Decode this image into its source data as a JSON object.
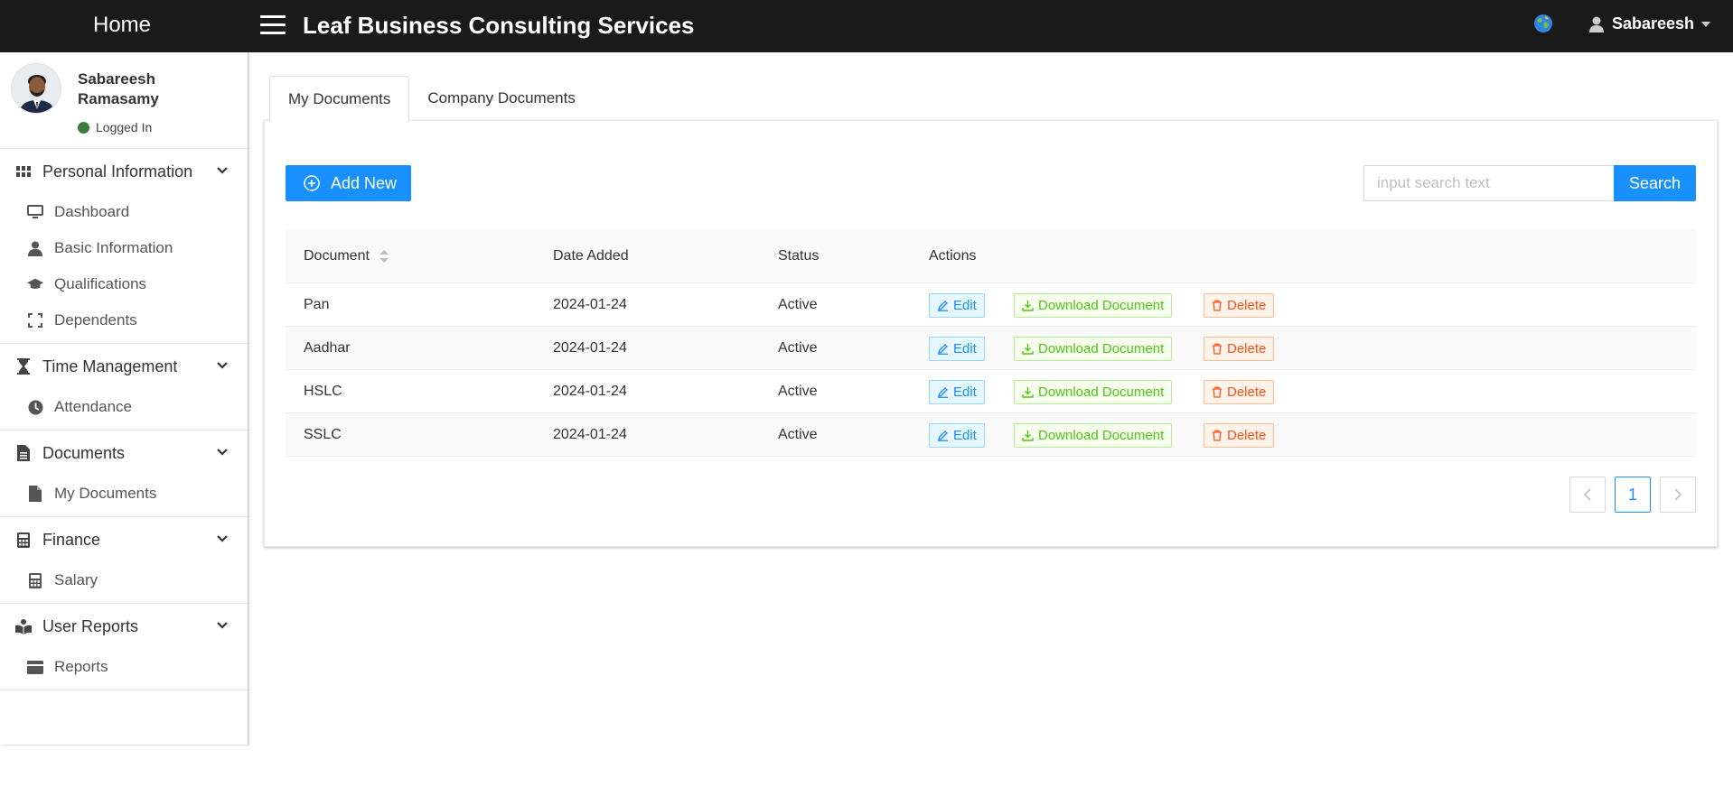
{
  "topbar": {
    "home_label": "Home",
    "company_name": "Leaf Business Consulting Services",
    "user_name": "Sabareesh",
    "icons": [
      "hamburger-icon",
      "globe-icon",
      "user-icon",
      "caret-down-icon"
    ]
  },
  "profile": {
    "name": "Sabareesh Ramasamy",
    "status": "Logged In",
    "status_color": "#3c7d3c"
  },
  "sidebar": {
    "groups": [
      {
        "label": "Personal Information",
        "icon": "grid-icon",
        "items": [
          {
            "label": "Dashboard",
            "icon": "monitor-icon"
          },
          {
            "label": "Basic Information",
            "icon": "person-icon"
          },
          {
            "label": "Qualifications",
            "icon": "graduation-cap-icon"
          },
          {
            "label": "Dependents",
            "icon": "expand-icon"
          }
        ]
      },
      {
        "label": "Time Management",
        "icon": "hourglass-icon",
        "items": [
          {
            "label": "Attendance",
            "icon": "clock-icon"
          }
        ]
      },
      {
        "label": "Documents",
        "icon": "file-text-icon",
        "items": [
          {
            "label": "My Documents",
            "icon": "file-icon"
          }
        ]
      },
      {
        "label": "Finance",
        "icon": "calculator-icon",
        "items": [
          {
            "label": "Salary",
            "icon": "calculator-icon"
          }
        ]
      },
      {
        "label": "User Reports",
        "icon": "book-reader-icon",
        "items": [
          {
            "label": "Reports",
            "icon": "card-icon"
          }
        ]
      }
    ]
  },
  "tabs": [
    {
      "label": "My Documents",
      "active": true
    },
    {
      "label": "Company Documents",
      "active": false
    }
  ],
  "toolbar": {
    "add_label": "Add New",
    "search_placeholder": "input search text",
    "search_value": "",
    "search_label": "Search"
  },
  "table": {
    "columns": [
      "Document",
      "Date Added",
      "Status",
      "Actions"
    ],
    "rows": [
      {
        "document": "Pan",
        "date": "2024-01-24",
        "status": "Active"
      },
      {
        "document": "Aadhar",
        "date": "2024-01-24",
        "status": "Active"
      },
      {
        "document": "HSLC",
        "date": "2024-01-24",
        "status": "Active"
      },
      {
        "document": "SSLC",
        "date": "2024-01-24",
        "status": "Active"
      }
    ],
    "actions": {
      "edit": "Edit",
      "download": "Download Document",
      "delete": "Delete"
    }
  },
  "pagination": {
    "current_page": "1"
  },
  "colors": {
    "primary": "#1890ff",
    "topbar_bg": "#1a1a1a",
    "edit": "#1890ff",
    "download": "#52c41a",
    "delete": "#fa541c"
  }
}
